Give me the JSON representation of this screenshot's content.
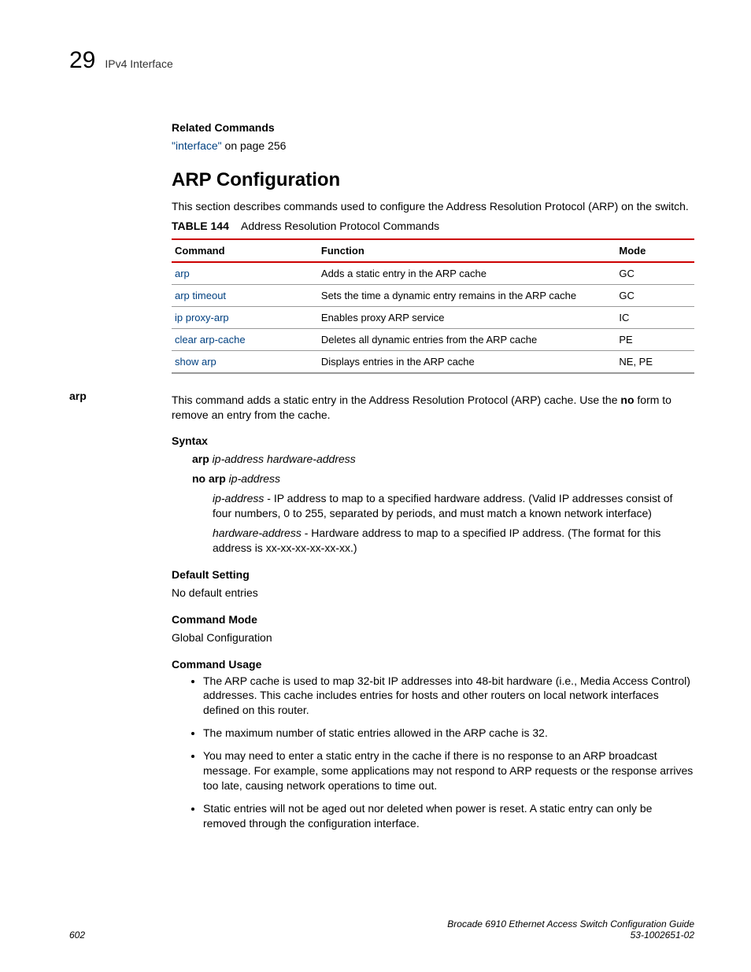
{
  "header": {
    "chapter_num": "29",
    "chapter_title": "IPv4 Interface"
  },
  "related": {
    "heading": "Related Commands",
    "link_text": "\"interface\"",
    "after_link": " on page 256"
  },
  "section_title": "ARP Configuration",
  "intro": "This section describes commands used to configure the Address Resolution Protocol (ARP) on the switch.",
  "table": {
    "label": "TABLE 144",
    "caption": "Address Resolution Protocol Commands",
    "headers": {
      "c1": "Command",
      "c2": "Function",
      "c3": "Mode"
    },
    "rows": [
      {
        "cmd": "arp",
        "func": "Adds a static entry in the ARP cache",
        "mode": "GC"
      },
      {
        "cmd": "arp timeout",
        "func": "Sets the time a dynamic entry remains in the ARP cache",
        "mode": "GC"
      },
      {
        "cmd": "ip proxy-arp",
        "func": "Enables proxy ARP service",
        "mode": "IC"
      },
      {
        "cmd": "clear arp-cache",
        "func": "Deletes all dynamic entries from the ARP cache",
        "mode": "PE"
      },
      {
        "cmd": "show arp",
        "func": "Displays entries in the ARP cache",
        "mode": "NE, PE"
      }
    ]
  },
  "arp": {
    "side": "arp",
    "desc_pre": "This command adds a static entry in the Address Resolution Protocol (ARP) cache. Use the ",
    "desc_bold": "no",
    "desc_post": " form to remove an entry from the cache.",
    "syntax_h": "Syntax",
    "syntax1_b": "arp",
    "syntax1_i": " ip-address hardware-address",
    "syntax2_b": "no arp",
    "syntax2_i": " ip-address",
    "param1_i": "ip-address",
    "param1_t": " - IP address to map to a specified hardware address. (Valid IP addresses consist of four numbers, 0 to 255, separated by periods, and must match a known network interface)",
    "param2_i": "hardware-address",
    "param2_t": " - Hardware address to map to a specified IP address. (The format for this address is xx-xx-xx-xx-xx-xx.)",
    "default_h": "Default Setting",
    "default_t": "No default entries",
    "mode_h": "Command Mode",
    "mode_t": "Global Configuration",
    "usage_h": "Command Usage",
    "bullets": [
      "The ARP cache is used to map 32-bit IP addresses into 48-bit hardware (i.e., Media Access Control) addresses. This cache includes entries for hosts and other routers on local network interfaces defined on this router.",
      "The maximum number of static entries allowed in the ARP cache is 32.",
      "You may need to enter a static entry in the cache if there is no response to an ARP broadcast message. For example, some applications may not respond to ARP requests or the response arrives too late, causing network operations to time out.",
      "Static entries will not be aged out nor deleted when power is reset. A static entry can only be removed through the configuration interface."
    ]
  },
  "footer": {
    "page": "602",
    "doc": "Brocade 6910 Ethernet Access Switch Configuration Guide",
    "num": "53-1002651-02"
  }
}
